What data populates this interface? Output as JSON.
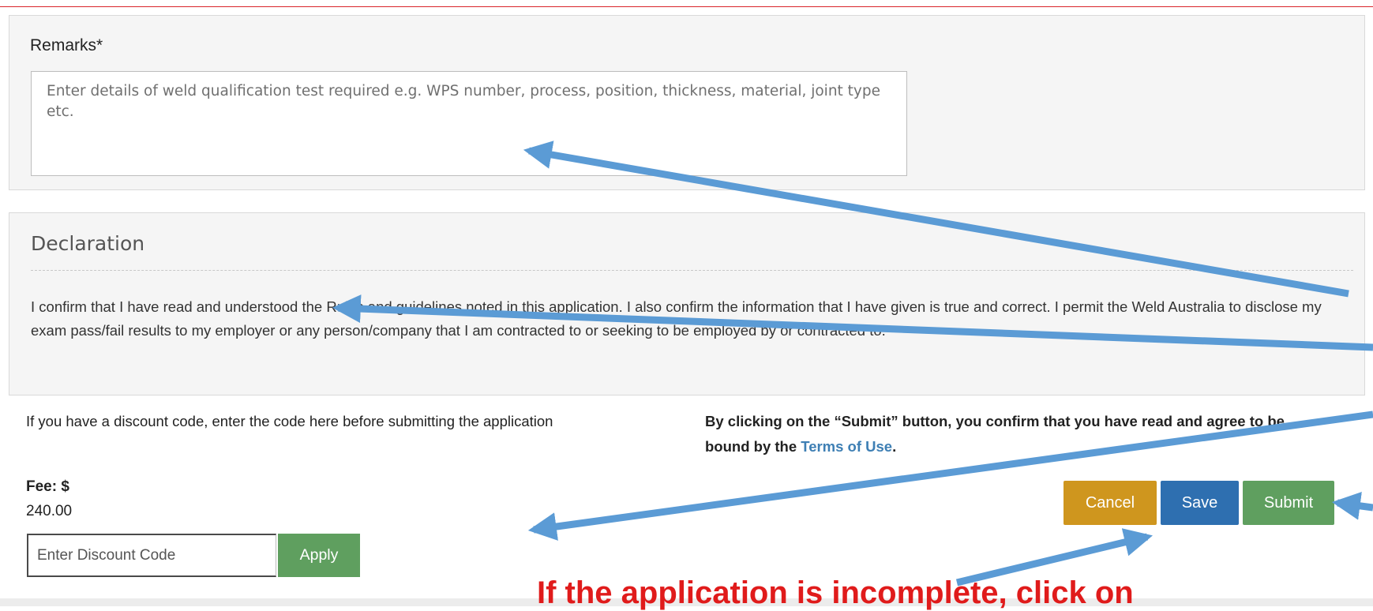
{
  "remarks": {
    "label": "Remarks*",
    "placeholder": "Enter details of weld qualification test required e.g. WPS number, process, position, thickness, material, joint type etc."
  },
  "declaration": {
    "title": "Declaration",
    "text": "I confirm that I have read and understood the Rules and guidelines noted in this application. I also confirm the information that I have given is true and correct. I permit the Weld Australia to disclose my exam pass/fail results to my employer or any person/company that I am contracted to or seeking to be employed by or contracted to."
  },
  "discount": {
    "note": "If you have a discount code, enter the code here before submitting the application",
    "fee_label": "Fee: $",
    "fee_value": "240.00",
    "input_placeholder": "Enter Discount Code",
    "apply_label": "Apply"
  },
  "terms": {
    "prefix": "By clicking on the “Submit” button, you confirm that you have read and agree to be bound by the ",
    "link": "Terms of Use",
    "suffix": "."
  },
  "actions": {
    "cancel_label": "Cancel",
    "save_label": "Save",
    "submit_label": "Submit"
  },
  "annotation": {
    "bottom_note": "If the application is incomplete, click on",
    "arrow_color": "#5b9bd5",
    "note_color": "#e01b1b"
  },
  "colors": {
    "cancel": "#cf961e",
    "save": "#2e6fb0",
    "submit": "#5f9f5f",
    "link": "#3e7fb4"
  }
}
